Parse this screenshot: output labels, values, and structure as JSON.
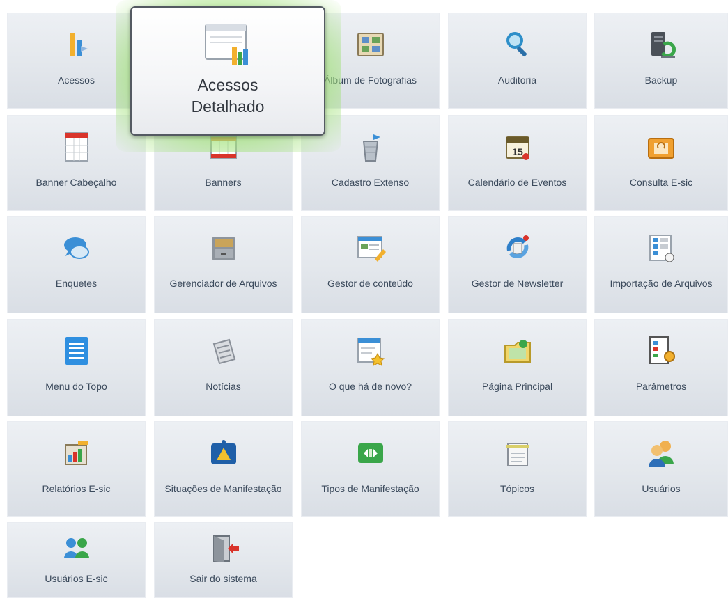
{
  "hovered_tile": {
    "label_line1": "Acessos",
    "label_line2": "Detalhado",
    "icon": "detailed-chart-icon"
  },
  "tiles": [
    {
      "label": "Acessos",
      "icon": "access-chart-icon"
    },
    {
      "label": "Álbum de Fotografias",
      "icon": "photo-album-icon"
    },
    {
      "label": "Auditoria",
      "icon": "magnifier-icon"
    },
    {
      "label": "Backup",
      "icon": "backup-server-icon"
    },
    {
      "label": "Banner Cabeçalho",
      "icon": "header-banner-icon"
    },
    {
      "label": "Banners",
      "icon": "banners-icon"
    },
    {
      "label": "Cadastro Extenso",
      "icon": "extended-register-icon"
    },
    {
      "label": "Calendário de Eventos",
      "icon": "calendar-icon"
    },
    {
      "label": "Consulta E-sic",
      "icon": "folder-consult-icon"
    },
    {
      "label": "Enquetes",
      "icon": "speech-bubbles-icon"
    },
    {
      "label": "Gerenciador de Arquivos",
      "icon": "file-cabinet-icon"
    },
    {
      "label": "Gestor de conteúdo",
      "icon": "content-editor-icon"
    },
    {
      "label": "Gestor de Newsletter",
      "icon": "newsletter-refresh-icon"
    },
    {
      "label": "Importação de Arquivos",
      "icon": "import-files-icon"
    },
    {
      "label": "Menu do Topo",
      "icon": "top-menu-icon"
    },
    {
      "label": "Notícias",
      "icon": "newspaper-icon"
    },
    {
      "label": "O que há de novo?",
      "icon": "whats-new-icon"
    },
    {
      "label": "Página Principal",
      "icon": "home-page-folder-icon"
    },
    {
      "label": "Parâmetros",
      "icon": "parameters-icon"
    },
    {
      "label": "Relatórios E-sic",
      "icon": "reports-icon"
    },
    {
      "label": "Situações de Manifestação",
      "icon": "warning-status-icon"
    },
    {
      "label": "Tipos de Manifestação",
      "icon": "manifestation-types-icon"
    },
    {
      "label": "Tópicos",
      "icon": "topics-notepad-icon"
    },
    {
      "label": "Usuários",
      "icon": "users-icon"
    },
    {
      "label": "Usuários E-sic",
      "icon": "esic-users-icon"
    },
    {
      "label": "Sair do sistema",
      "icon": "exit-door-icon"
    }
  ],
  "colors": {
    "tile_background": "#e3e7ec",
    "label_text": "#3b4a5c",
    "hover_glow": "#a8e07a"
  }
}
